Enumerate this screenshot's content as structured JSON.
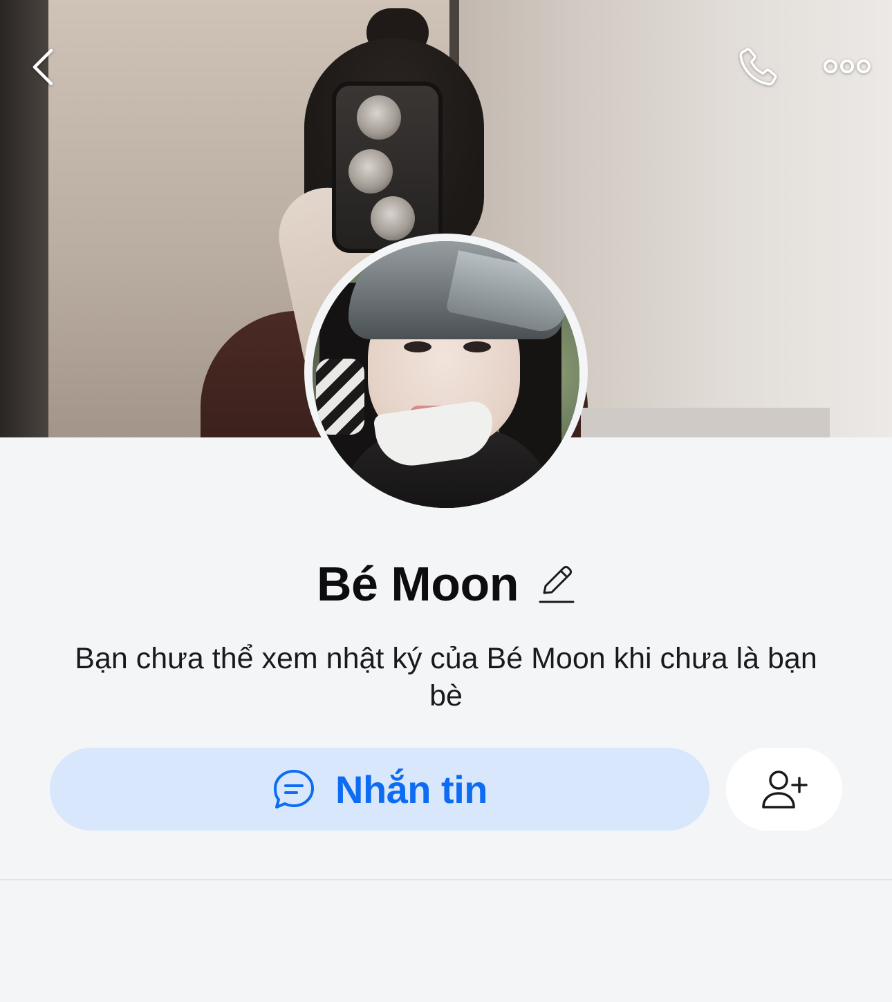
{
  "header": {
    "back_icon": "chevron-left-icon",
    "call_icon": "phone-icon",
    "more_icon": "more-horizontal-icon"
  },
  "profile": {
    "name": "Bé Moon",
    "edit_icon": "pencil-icon",
    "privacy_message": "Bạn chưa thể xem nhật ký của Bé Moon khi chưa là bạn bè"
  },
  "actions": {
    "message_label": "Nhắn tin",
    "message_icon": "chat-bubble-icon",
    "add_friend_icon": "add-user-icon"
  },
  "colors": {
    "accent": "#0d6cf2",
    "message_button_bg": "#d8e7fb",
    "page_bg": "#f4f5f7"
  }
}
